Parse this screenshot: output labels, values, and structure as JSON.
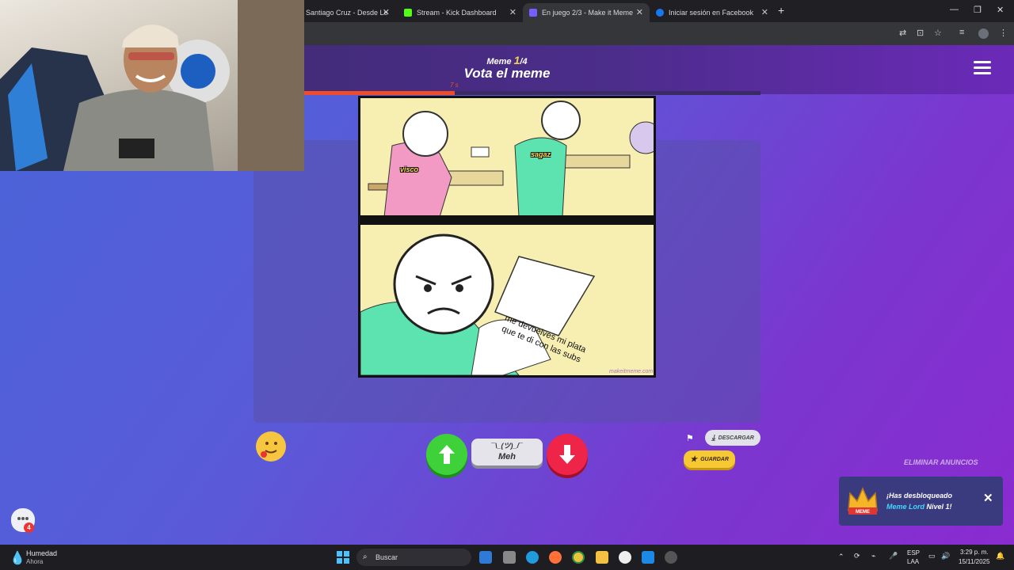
{
  "browser": {
    "tabs": [
      {
        "title": "Santiago Cruz - Desde Le",
        "active": false
      },
      {
        "title": "Stream - Kick Dashboard",
        "active": false
      },
      {
        "title": "En juego 2/3 - Make it Meme",
        "active": true
      },
      {
        "title": "Iniciar sesión en Facebook",
        "active": false
      }
    ],
    "new_tab": "+",
    "close_glyph": "✕"
  },
  "game": {
    "round_prefix": "Meme",
    "round_current": "1",
    "round_total": "/4",
    "title": "Vota el meme",
    "timer_label": "7 s",
    "timer_fraction": 0.33
  },
  "meme": {
    "caption_left": "visco",
    "caption_right": "sagaz",
    "note_text": "me devuelves mi plata que te di con las subs",
    "watermark": "makeitmeme.com"
  },
  "controls": {
    "meh_face": "¯\\_(ツ)_/¯",
    "meh_label": "Meh",
    "download_label": "DESCARGAR",
    "save_label": "GUARDAR",
    "remove_ads_label": "ELIMINAR ANUNCIOS"
  },
  "toast": {
    "prefix": "¡Has desbloqueado ",
    "highlight": "Meme Lord",
    "suffix": " Nivel 1!",
    "badge_text": "MEME"
  },
  "chat": {
    "badge_count": "4"
  },
  "taskbar": {
    "weather_title": "Humedad",
    "weather_sub": "Ahora",
    "search_placeholder": "Buscar",
    "lang_top": "ESP",
    "lang_bottom": "LAA",
    "time": "3:29 p. m.",
    "date": "15/11/2025"
  },
  "colors": {
    "accent_up": "#3ed13a",
    "accent_down": "#ee2449",
    "timer": "#ef4d2a",
    "save": "#f6c834"
  }
}
